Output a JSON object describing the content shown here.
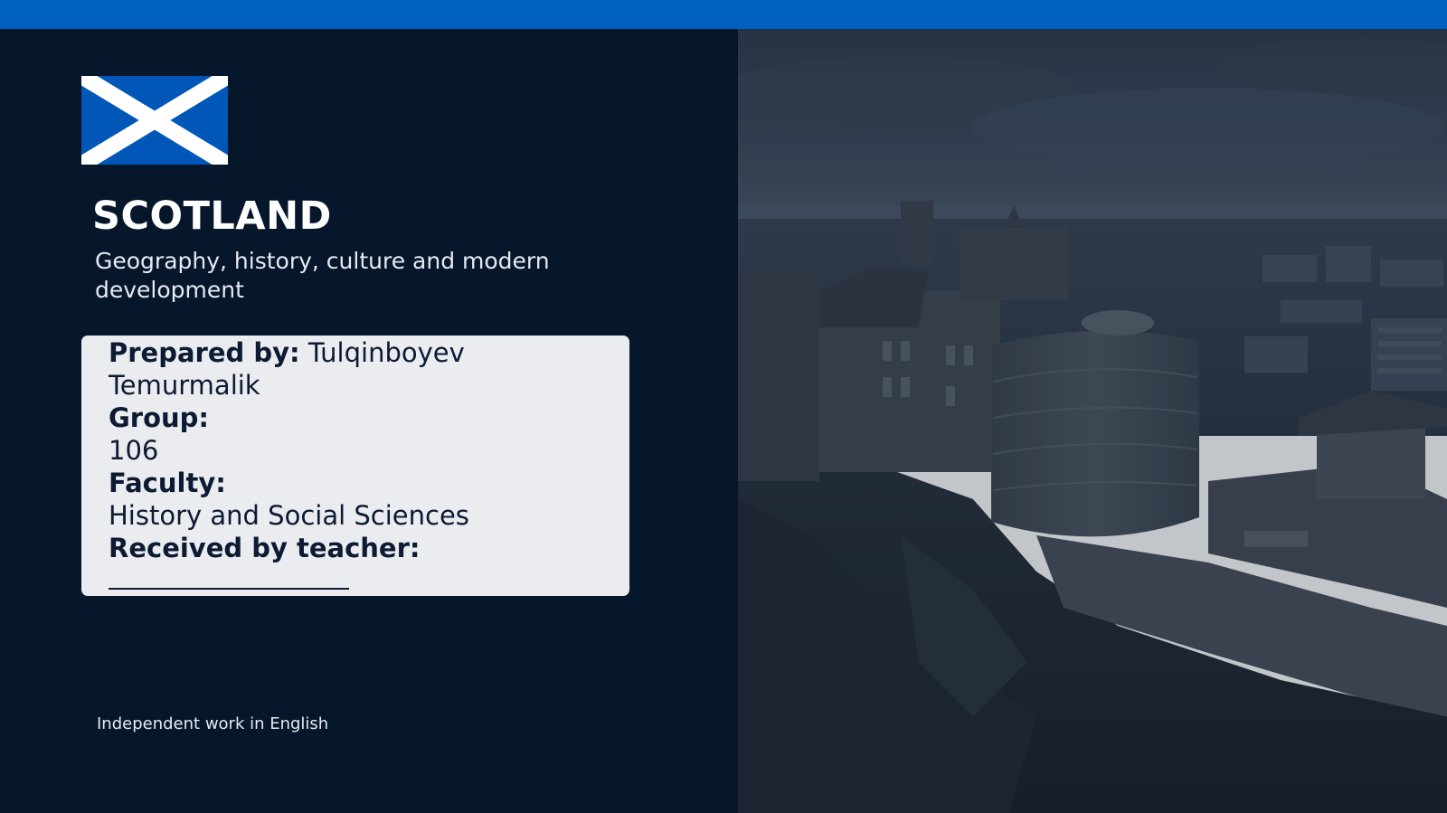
{
  "colors": {
    "top_bar": "#0060bf",
    "left_panel": "#06162b",
    "card_background": "#eaecef",
    "card_text": "#0d1a33",
    "flag_blue": "#0057b8",
    "flag_cross": "#ffffff"
  },
  "slide": {
    "flag_icon": "scotland-saltire-flag",
    "title": "SCOTLAND",
    "subtitle": "Geography, history, culture and modern development",
    "footer_note": "Independent work in English"
  },
  "info_card": {
    "prepared_label": "Prepared by:",
    "prepared_value_1": " Tulqinboyev",
    "prepared_value_2": "Temurmalik",
    "group_label": "Group:",
    "group_value": "106",
    "faculty_label": "Faculty:",
    "faculty_value": "History and Social Sciences",
    "received_label": "Received by teacher:"
  },
  "photo": {
    "subject": "aerial view of a stone castle on a rocky hill above a city under an overcast sky"
  }
}
